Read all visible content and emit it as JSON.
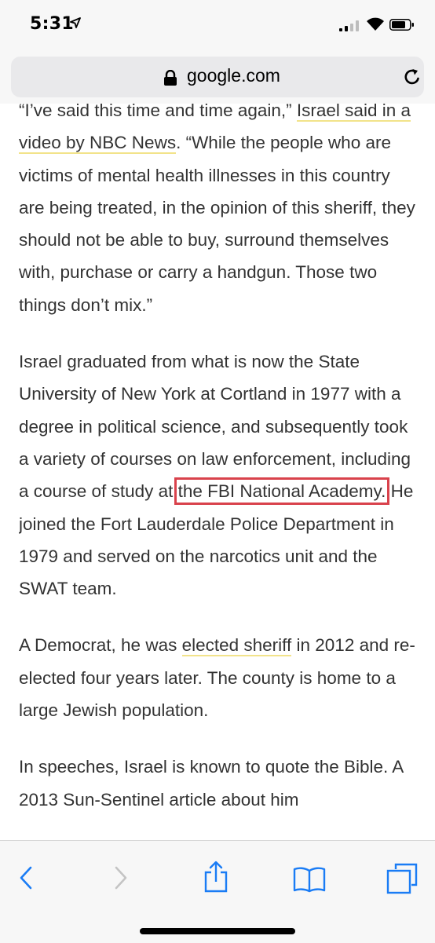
{
  "status_bar": {
    "time": "5:31"
  },
  "address_bar": {
    "domain": "google.com"
  },
  "article": {
    "p1_a": "“I’ve said this time and time again,” ",
    "p1_link": "Israel said in a video by NBC News",
    "p1_b": ". “While the people who are victims of mental health illnesses in this country are being treated, in the opinion of this sheriff, they should not be able to buy, surround themselves with, purchase or carry a handgun. Those two things don’t mix.”",
    "p2_a": "Israel graduated from what is now the State University of New York at Cortland in 1977 with a degree in political science, and subsequently took a variety of courses on law enforcement, including a course of study at ",
    "p2_highlight": "the FBI National Academy.",
    "p2_b": " He joined the Fort Lauderdale Police Department in 1979 and served on the narcotics unit and the SWAT team.",
    "p3_a": "A Democrat, he was ",
    "p3_link": "elected sheriff",
    "p3_b": " in 2012 and re-elected four years later. The county is home to a large Jewish population.",
    "p4": "In speeches, Israel is known to quote the Bible. A 2013 Sun-Sentinel article about him"
  },
  "toolbar": {
    "icons": [
      "back-icon",
      "forward-icon",
      "share-icon",
      "bookmarks-icon",
      "tabs-icon"
    ]
  },
  "colors": {
    "link_underline": "#f2e38a",
    "highlight_box": "#d9424c",
    "ios_blue": "#1a7cf5"
  }
}
